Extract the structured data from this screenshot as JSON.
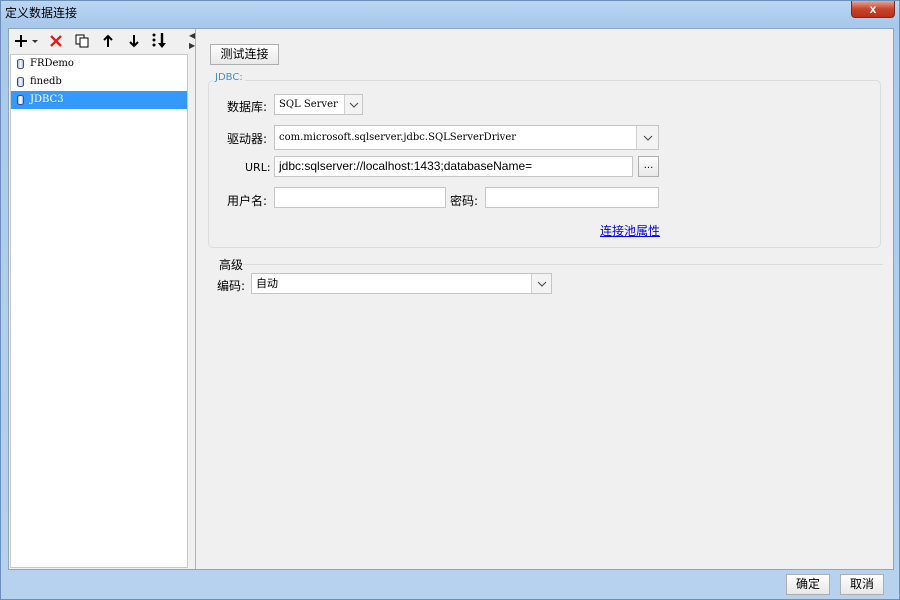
{
  "window": {
    "title": "定义数据连接",
    "close_label": "x"
  },
  "toolbar": {
    "items": [
      "add-icon",
      "delete-icon",
      "copy-icon",
      "move-up-icon",
      "move-down-icon",
      "sort-icon"
    ]
  },
  "connections": [
    {
      "name": "FRDemo",
      "selected": false
    },
    {
      "name": "finedb",
      "selected": false
    },
    {
      "name": "JDBC3",
      "selected": true
    }
  ],
  "test_button": "测试连接",
  "jdbc": {
    "group_title": "JDBC:",
    "database_label": "数据库:",
    "database_value": "SQL Server",
    "driver_label": "驱动器:",
    "driver_value": "com.microsoft.sqlserver.jdbc.SQLServerDriver",
    "url_label": "URL:",
    "url_value": "jdbc:sqlserver://localhost:1433;databaseName=",
    "browse_label": "...",
    "username_label": "用户名:",
    "username_value": "",
    "password_label": "密码:",
    "password_value": "",
    "pool_link": "连接池属性"
  },
  "advanced": {
    "title": "高级",
    "encoding_label": "编码:",
    "encoding_value": "自动"
  },
  "footer": {
    "ok": "确定",
    "cancel": "取消"
  }
}
